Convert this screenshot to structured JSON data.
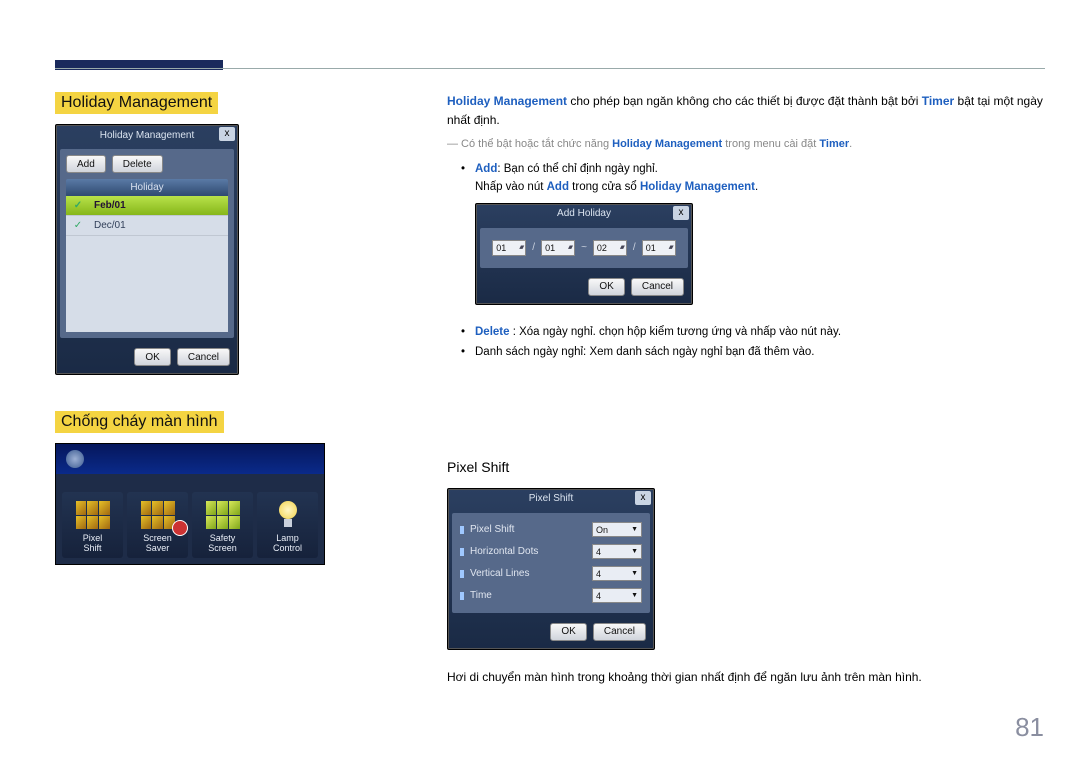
{
  "page_number": "81",
  "sections": {
    "holiday": {
      "title": "Holiday Management",
      "intro_pre": "Holiday Management",
      "intro_post": " cho phép bạn ngăn không cho các thiết bị được đặt thành bật bởi ",
      "intro_timer": "Timer",
      "intro_tail": " bật tại một ngày nhất định.",
      "note_pre": "― Có thể bật hoặc tắt chức năng ",
      "note_hm": "Holiday Management",
      "note_mid": " trong menu cài đặt ",
      "note_timer": "Timer",
      "note_end": ".",
      "add_label": "Add",
      "add_text": ": Bạn có thể chỉ định ngày nghỉ.",
      "add_sub_pre": "Nhấp vào nút ",
      "add_sub_add": "Add",
      "add_sub_mid": " trong cửa sổ ",
      "add_sub_hm": "Holiday Management",
      "add_sub_end": ".",
      "delete_label": "Delete",
      "delete_text": " : Xóa ngày nghỉ. chọn hộp kiểm tương ứng và nhấp vào nút này.",
      "list_text": "Danh sách ngày nghỉ: Xem danh sách ngày nghỉ bạn đã thêm vào."
    },
    "shot_hm": {
      "title": "Holiday Management",
      "close": "x",
      "btn_add": "Add",
      "btn_delete": "Delete",
      "list_header": "Holiday",
      "rows": [
        "Feb/01",
        "Dec/01"
      ],
      "ok": "OK",
      "cancel": "Cancel"
    },
    "shot_add": {
      "title": "Add Holiday",
      "close": "x",
      "m1": "01",
      "d1": "01",
      "m2": "02",
      "d2": "01",
      "tilde": "~",
      "slash": "/",
      "ok": "OK",
      "cancel": "Cancel"
    },
    "burn": {
      "title": "Chống cháy màn hình",
      "icons": {
        "pixel_shift": "Pixel\nShift",
        "screen_saver": "Screen\nSaver",
        "safety_screen": "Safety\nScreen",
        "lamp_control": "Lamp\nControl"
      }
    },
    "pixel_shift": {
      "heading": "Pixel Shift",
      "title": "Pixel Shift",
      "close": "x",
      "rows": {
        "ps_label": "Pixel Shift",
        "ps_val": "On",
        "hd_label": "Horizontal Dots",
        "hd_val": "4",
        "vl_label": "Vertical Lines",
        "vl_val": "4",
        "tm_label": "Time",
        "tm_val": "4"
      },
      "ok": "OK",
      "cancel": "Cancel",
      "desc": "Hơi di chuyển màn hình trong khoảng thời gian nhất định để ngăn lưu ảnh trên màn hình."
    }
  }
}
